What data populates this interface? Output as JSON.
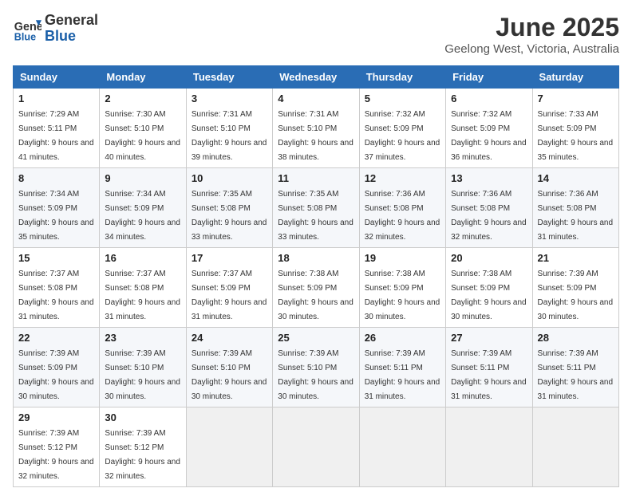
{
  "header": {
    "logo_line1": "General",
    "logo_line2": "Blue",
    "main_title": "June 2025",
    "subtitle": "Geelong West, Victoria, Australia"
  },
  "calendar": {
    "days_of_week": [
      "Sunday",
      "Monday",
      "Tuesday",
      "Wednesday",
      "Thursday",
      "Friday",
      "Saturday"
    ],
    "weeks": [
      [
        {
          "day": "1",
          "sunrise": "7:29 AM",
          "sunset": "5:11 PM",
          "daylight": "9 hours and 41 minutes."
        },
        {
          "day": "2",
          "sunrise": "7:30 AM",
          "sunset": "5:10 PM",
          "daylight": "9 hours and 40 minutes."
        },
        {
          "day": "3",
          "sunrise": "7:31 AM",
          "sunset": "5:10 PM",
          "daylight": "9 hours and 39 minutes."
        },
        {
          "day": "4",
          "sunrise": "7:31 AM",
          "sunset": "5:10 PM",
          "daylight": "9 hours and 38 minutes."
        },
        {
          "day": "5",
          "sunrise": "7:32 AM",
          "sunset": "5:09 PM",
          "daylight": "9 hours and 37 minutes."
        },
        {
          "day": "6",
          "sunrise": "7:32 AM",
          "sunset": "5:09 PM",
          "daylight": "9 hours and 36 minutes."
        },
        {
          "day": "7",
          "sunrise": "7:33 AM",
          "sunset": "5:09 PM",
          "daylight": "9 hours and 35 minutes."
        }
      ],
      [
        {
          "day": "8",
          "sunrise": "7:34 AM",
          "sunset": "5:09 PM",
          "daylight": "9 hours and 35 minutes."
        },
        {
          "day": "9",
          "sunrise": "7:34 AM",
          "sunset": "5:09 PM",
          "daylight": "9 hours and 34 minutes."
        },
        {
          "day": "10",
          "sunrise": "7:35 AM",
          "sunset": "5:08 PM",
          "daylight": "9 hours and 33 minutes."
        },
        {
          "day": "11",
          "sunrise": "7:35 AM",
          "sunset": "5:08 PM",
          "daylight": "9 hours and 33 minutes."
        },
        {
          "day": "12",
          "sunrise": "7:36 AM",
          "sunset": "5:08 PM",
          "daylight": "9 hours and 32 minutes."
        },
        {
          "day": "13",
          "sunrise": "7:36 AM",
          "sunset": "5:08 PM",
          "daylight": "9 hours and 32 minutes."
        },
        {
          "day": "14",
          "sunrise": "7:36 AM",
          "sunset": "5:08 PM",
          "daylight": "9 hours and 31 minutes."
        }
      ],
      [
        {
          "day": "15",
          "sunrise": "7:37 AM",
          "sunset": "5:08 PM",
          "daylight": "9 hours and 31 minutes."
        },
        {
          "day": "16",
          "sunrise": "7:37 AM",
          "sunset": "5:08 PM",
          "daylight": "9 hours and 31 minutes."
        },
        {
          "day": "17",
          "sunrise": "7:37 AM",
          "sunset": "5:09 PM",
          "daylight": "9 hours and 31 minutes."
        },
        {
          "day": "18",
          "sunrise": "7:38 AM",
          "sunset": "5:09 PM",
          "daylight": "9 hours and 30 minutes."
        },
        {
          "day": "19",
          "sunrise": "7:38 AM",
          "sunset": "5:09 PM",
          "daylight": "9 hours and 30 minutes."
        },
        {
          "day": "20",
          "sunrise": "7:38 AM",
          "sunset": "5:09 PM",
          "daylight": "9 hours and 30 minutes."
        },
        {
          "day": "21",
          "sunrise": "7:39 AM",
          "sunset": "5:09 PM",
          "daylight": "9 hours and 30 minutes."
        }
      ],
      [
        {
          "day": "22",
          "sunrise": "7:39 AM",
          "sunset": "5:09 PM",
          "daylight": "9 hours and 30 minutes."
        },
        {
          "day": "23",
          "sunrise": "7:39 AM",
          "sunset": "5:10 PM",
          "daylight": "9 hours and 30 minutes."
        },
        {
          "day": "24",
          "sunrise": "7:39 AM",
          "sunset": "5:10 PM",
          "daylight": "9 hours and 30 minutes."
        },
        {
          "day": "25",
          "sunrise": "7:39 AM",
          "sunset": "5:10 PM",
          "daylight": "9 hours and 30 minutes."
        },
        {
          "day": "26",
          "sunrise": "7:39 AM",
          "sunset": "5:11 PM",
          "daylight": "9 hours and 31 minutes."
        },
        {
          "day": "27",
          "sunrise": "7:39 AM",
          "sunset": "5:11 PM",
          "daylight": "9 hours and 31 minutes."
        },
        {
          "day": "28",
          "sunrise": "7:39 AM",
          "sunset": "5:11 PM",
          "daylight": "9 hours and 31 minutes."
        }
      ],
      [
        {
          "day": "29",
          "sunrise": "7:39 AM",
          "sunset": "5:12 PM",
          "daylight": "9 hours and 32 minutes."
        },
        {
          "day": "30",
          "sunrise": "7:39 AM",
          "sunset": "5:12 PM",
          "daylight": "9 hours and 32 minutes."
        },
        null,
        null,
        null,
        null,
        null
      ]
    ]
  }
}
